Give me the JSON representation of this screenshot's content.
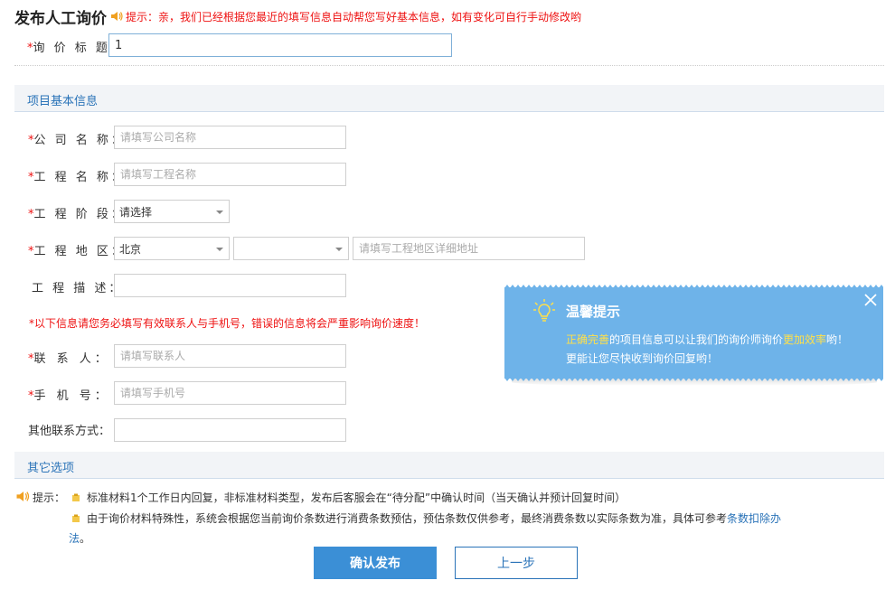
{
  "header": {
    "title": "发布人工询价",
    "hint": "提示：亲，我们已经根据您最近的填写信息自动帮您写好基本信息，如有变化可自行手动修改哟"
  },
  "inquiry_title": {
    "required_mark": "*",
    "label": "询 价 标 题：",
    "value": "1"
  },
  "section_basic": {
    "title": "项目基本信息"
  },
  "fields": {
    "company": {
      "required_mark": "*",
      "label": "公 司 名 称：",
      "placeholder": "请填写公司名称"
    },
    "project": {
      "required_mark": "*",
      "label": "工 程 名 称：",
      "placeholder": "请填写工程名称"
    },
    "stage": {
      "required_mark": "*",
      "label": "工 程 阶 段：",
      "selected": "请选择"
    },
    "region": {
      "required_mark": "*",
      "label": "工 程 地 区：",
      "province": "北京",
      "city": "",
      "address_placeholder": "请填写工程地区详细地址"
    },
    "description": {
      "label": "工 程 描 述：",
      "value": ""
    }
  },
  "contact_warning": "*以下信息请您务必填写有效联系人与手机号，错误的信息将会严重影响询价速度！",
  "contact": {
    "person": {
      "required_mark": "*",
      "label": "联  系  人：",
      "placeholder": "请填写联系人"
    },
    "phone": {
      "required_mark": "*",
      "label": "手  机  号：",
      "placeholder": "请填写手机号"
    },
    "other": {
      "label": "其他联系方式：",
      "value": ""
    }
  },
  "tip_card": {
    "title": "温馨提示",
    "line1_a": "正确完善",
    "line1_b": "的项目信息可以让我们的询价师询价",
    "line1_c": "更加效率",
    "line1_d": "哟！",
    "line2": "更能让您尽快收到询价回复哟！"
  },
  "section_other": {
    "title": "其它选项"
  },
  "hints": {
    "label": "提示：",
    "item1": "标准材料1个工作日内回复，非标准材料类型，发布后客服会在“待分配”中确认时间（当天确认并预计回复时间）",
    "item2": "由于询价材料特殊性，系统会根据您当前询价条数进行消费条数预估，预估条数仅供参考，最终消费条数以实际条数为准，具体可参考",
    "item2_link_a": "条数扣除办",
    "item2_link_b": "法",
    "item2_tail": "。"
  },
  "buttons": {
    "confirm": "确认发布",
    "back": "上一步"
  },
  "colors": {
    "accent": "#2a73b8",
    "primary_button": "#3b8fd6",
    "required": "#e11111",
    "tip_bg": "#6eb3e9",
    "tip_highlight": "#ffe04a"
  }
}
